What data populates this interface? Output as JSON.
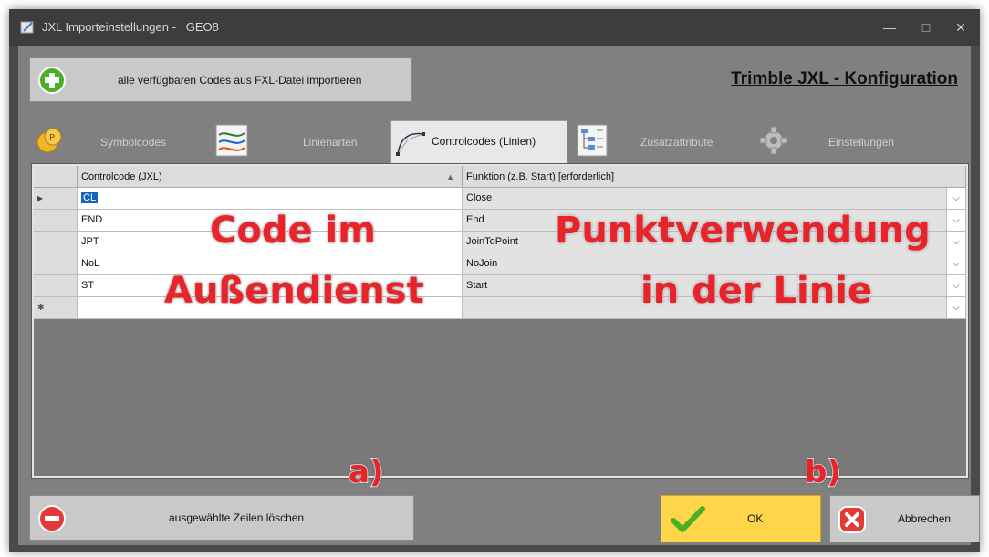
{
  "window": {
    "title": "JXL Importeinstellungen -   GEO8",
    "controls": {
      "minimize": "—",
      "maximize": "□",
      "close": "✕"
    }
  },
  "toolbar": {
    "import_button_label": "alle verfügbaren Codes aus FXL-Datei importieren",
    "brand_title": "Trimble JXL - Konfiguration"
  },
  "tabs": [
    {
      "label": "Symbolcodes",
      "icon": "symbol-codes-icon",
      "active": false
    },
    {
      "label": "Linienarten",
      "icon": "line-types-icon",
      "active": false
    },
    {
      "label": "Controlcodes (Linien)",
      "icon": "control-curve-icon",
      "active": true
    },
    {
      "label": "Zusatzattribute",
      "icon": "attributes-tree-icon",
      "active": false
    },
    {
      "label": "Einstellungen",
      "icon": "gear-icon",
      "active": false
    }
  ],
  "grid": {
    "columns": {
      "code": "Controlcode (JXL)",
      "sort_indicator": "▲",
      "function": "Funktion (z.B. Start) [erforderlich]"
    },
    "rows": [
      {
        "code": "CL",
        "function": "Close"
      },
      {
        "code": "END",
        "function": "End"
      },
      {
        "code": "JPT",
        "function": "JoinToPoint"
      },
      {
        "code": "NoL",
        "function": "NoJoin"
      },
      {
        "code": "ST",
        "function": "Start"
      },
      {
        "code": "",
        "function": ""
      }
    ],
    "current_row_marker": "▶",
    "new_row_marker": "✱"
  },
  "annotations": {
    "left_line1": "Code im",
    "left_line2": "Außendienst",
    "right_line1": "Punktverwendung",
    "right_line2": "in der Linie",
    "label_a": "a)",
    "label_b": "b)"
  },
  "footer": {
    "delete_button_label": "ausgewählte Zeilen löschen",
    "ok_label": "OK",
    "cancel_label": "Abbrechen"
  },
  "colors": {
    "ok_button": "#ffd54a",
    "annotation": "#e8242a",
    "selection": "#1565c0"
  }
}
